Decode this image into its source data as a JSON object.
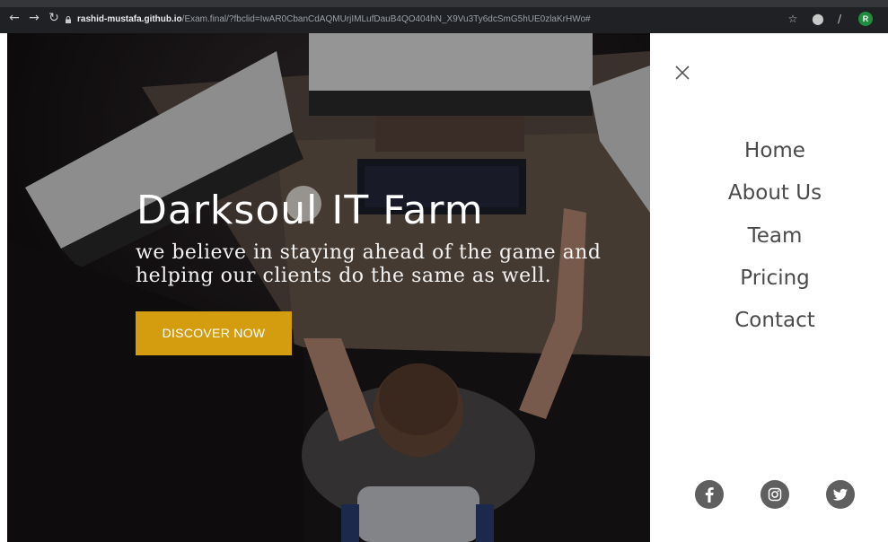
{
  "browser": {
    "url_host": "rashid-mustafa.github.io",
    "url_path": "/Exam.final/?fbclid=IwAR0CbanCdAQMUrjIMLufDauB4QO404hN_X9Vu3Ty6dcSmG5hUE0zlaKrHWo#",
    "profile_initial": "R"
  },
  "hero": {
    "title": "Darksoul IT Farm",
    "subtitle_line1": "we believe in staying ahead of the game and",
    "subtitle_line2": "helping our clients do the same as well.",
    "cta_label": "DISCOVER NOW"
  },
  "menu": {
    "items": [
      {
        "label": "Home"
      },
      {
        "label": "About Us"
      },
      {
        "label": "Team"
      },
      {
        "label": "Pricing"
      },
      {
        "label": "Contact"
      }
    ]
  },
  "social": [
    "facebook-icon",
    "instagram-icon",
    "twitter-icon"
  ],
  "colors": {
    "accent": "#d39d0f",
    "menu_text": "#4a4a4a",
    "social_bg": "#5f5f5f",
    "chrome_bg": "#202124"
  }
}
